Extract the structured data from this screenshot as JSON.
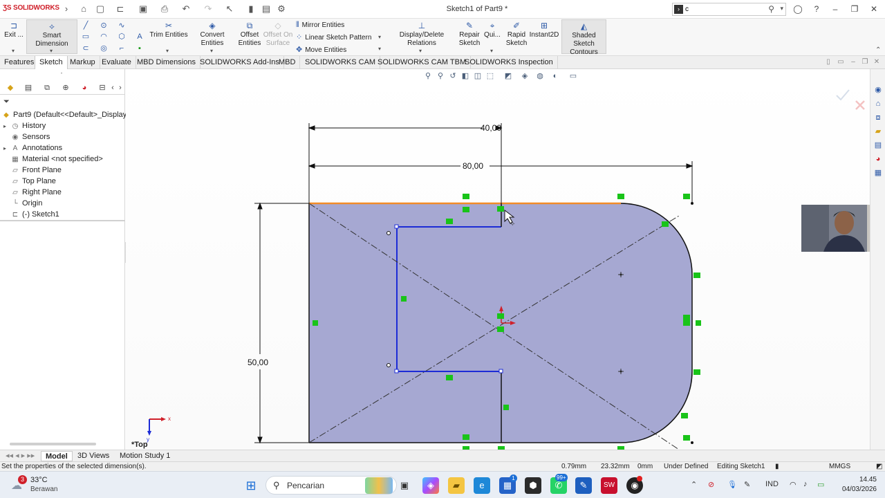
{
  "app": {
    "logo_text": "SOLIDWORKS",
    "doc_title": "Sketch1 of Part9 *",
    "search_value": "c"
  },
  "commands": {
    "exit_label": "Exit ...",
    "smart_dimension": "Smart Dimension",
    "trim_entities": "Trim Entities",
    "convert_entities": "Convert Entities",
    "offset_entities_1": "Offset",
    "offset_entities_2": "Entities",
    "offset_on_surface_1": "Offset On",
    "offset_on_surface_2": "Surface",
    "mirror_entities": "Mirror Entities",
    "linear_sketch_pattern": "Linear Sketch Pattern",
    "move_entities": "Move Entities",
    "display_delete_relations": "Display/Delete Relations",
    "repair_sketch_1": "Repair",
    "repair_sketch_2": "Sketch",
    "quick_snaps": "Qui...",
    "rapid_sketch_1": "Rapid",
    "rapid_sketch_2": "Sketch",
    "instant2d": "Instant2D",
    "shaded_contours_1": "Shaded Sketch",
    "shaded_contours_2": "Contours"
  },
  "tabs": [
    "Features",
    "Sketch",
    "Markup",
    "Evaluate",
    "MBD Dimensions",
    "SOLIDWORKS Add-Ins",
    "MBD",
    "SOLIDWORKS CAM",
    "SOLIDWORKS CAM TBM",
    "SOLIDWORKS Inspection"
  ],
  "active_tab": "Sketch",
  "tree": {
    "root": "Part9  (Default<<Default>_Display S",
    "items": [
      "History",
      "Sensors",
      "Annotations",
      "Material <not specified>",
      "Front Plane",
      "Top Plane",
      "Right Plane",
      "Origin",
      "(-) Sketch1"
    ]
  },
  "sketch": {
    "dim_top": "40,00",
    "dim_width": "80,00",
    "dim_height": "50,00",
    "view_label": "*Top",
    "axis_x": "x",
    "axis_y": "y"
  },
  "bottom_tabs": [
    "Model",
    "3D Views",
    "Motion Study 1"
  ],
  "status": {
    "message": "Set the properties of the selected dimension(s).",
    "x": "0.79mm",
    "y": "23.32mm",
    "z": "0mm",
    "state": "Under Defined",
    "editing": "Editing Sketch1",
    "units": "MMGS"
  },
  "taskbar": {
    "weather_temp": "33°C",
    "weather_desc": "Berawan",
    "weather_badge": "3",
    "search_label": "Pencarian",
    "whatsapp_badge": "99+",
    "language": "IND",
    "time": "14.45",
    "date": "04/03/2026"
  },
  "colors": {
    "sketch_fill": "#a6a8d2",
    "sketch_line": "#111111",
    "selected_line": "#f28c28",
    "active_line": "#1c2bd6",
    "relation_green": "#19c419",
    "brand_red": "#d0202a"
  }
}
